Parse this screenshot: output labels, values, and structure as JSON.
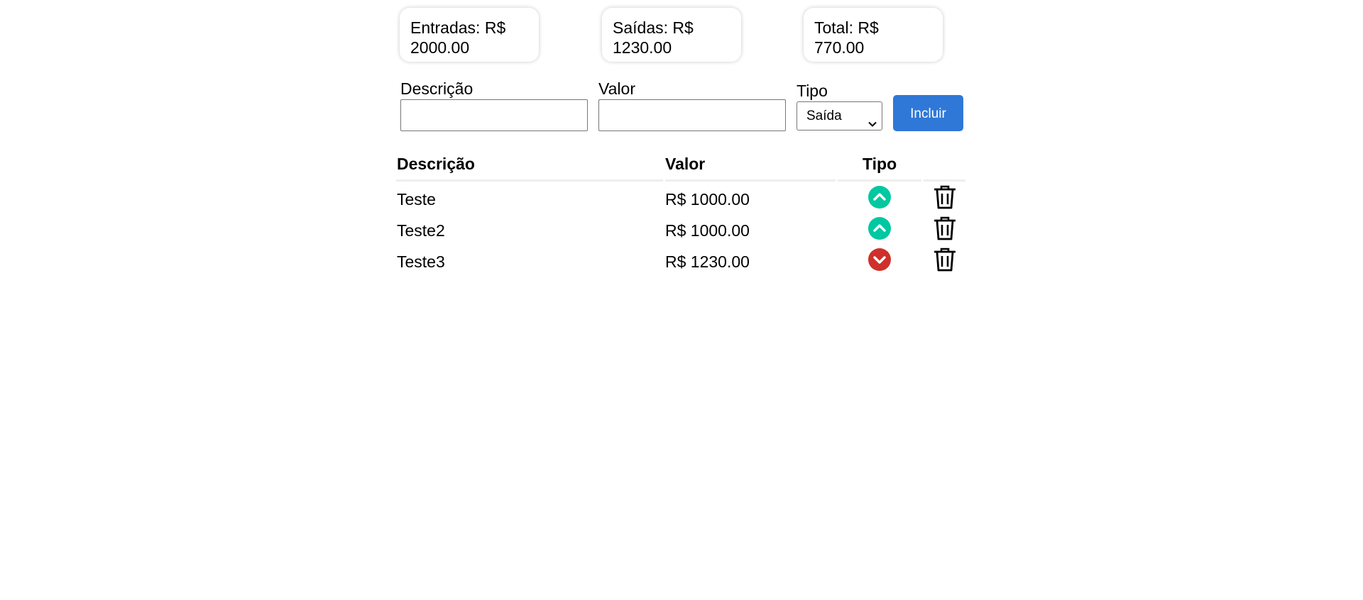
{
  "summary": {
    "entradas": {
      "label": "Entradas: R$",
      "value": "2000.00"
    },
    "saidas": {
      "label": "Saídas: R$",
      "value": "1230.00"
    },
    "total": {
      "label": "Total: R$",
      "value": "770.00"
    }
  },
  "form": {
    "descricao_label": "Descrição",
    "descricao_value": "",
    "valor_label": "Valor",
    "valor_value": "",
    "tipo_label": "Tipo",
    "tipo_selected": "Saída",
    "submit_label": "Incluir"
  },
  "table": {
    "headers": [
      "Descrição",
      "Valor",
      "Tipo",
      ""
    ],
    "rows": [
      {
        "descricao": "Teste",
        "valor": "R$ 1000.00",
        "tipo": "entrada",
        "tipo_icon": "arrow-up-circle-icon",
        "delete_icon": "trash-icon"
      },
      {
        "descricao": "Teste2",
        "valor": "R$ 1000.00",
        "tipo": "entrada",
        "tipo_icon": "arrow-up-circle-icon",
        "delete_icon": "trash-icon"
      },
      {
        "descricao": "Teste3",
        "valor": "R$ 1230.00",
        "tipo": "saida",
        "tipo_icon": "arrow-down-circle-icon",
        "delete_icon": "trash-icon"
      }
    ]
  },
  "colors": {
    "entrada": "#00c8a0",
    "saida": "#d0302a",
    "button": "#2f78d8"
  }
}
